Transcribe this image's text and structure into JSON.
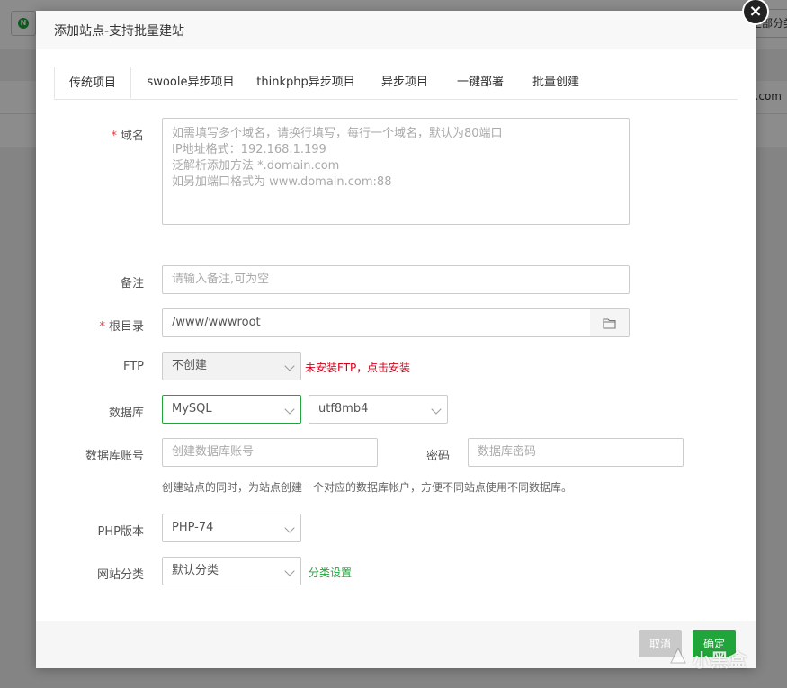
{
  "background": {
    "filter_label": "全部分类",
    "row_text": ".com"
  },
  "dialog": {
    "title": "添加站点-支持批量建站",
    "close_glyph": "×"
  },
  "tabs": [
    {
      "label": "传统项目",
      "active": true
    },
    {
      "label": "swoole异步项目",
      "active": false
    },
    {
      "label": "thinkphp异步项目",
      "active": false
    },
    {
      "label": "异步项目",
      "active": false
    },
    {
      "label": "一键部署",
      "active": false
    },
    {
      "label": "批量创建",
      "active": false
    }
  ],
  "form": {
    "domain": {
      "label": "域名",
      "placeholder_lines": [
        "如需填写多个域名，请换行填写，每行一个域名，默认为80端口",
        "IP地址格式：192.168.1.199",
        "泛解析添加方法 *.domain.com",
        "如另加端口格式为 www.domain.com:88"
      ]
    },
    "remark": {
      "label": "备注",
      "placeholder": "请输入备注,可为空"
    },
    "root": {
      "label": "根目录",
      "value": "/www/wwwroot",
      "folder_icon": "folder-icon"
    },
    "ftp": {
      "label": "FTP",
      "value": "不创建",
      "warning": "未安装FTP，",
      "install_link": "点击安装"
    },
    "database": {
      "label": "数据库",
      "type": "MySQL",
      "charset": "utf8mb4"
    },
    "db_account": {
      "label": "数据库账号",
      "placeholder": "创建数据库账号",
      "password_label": "密码",
      "password_placeholder": "数据库密码",
      "hint": "创建站点的同时，为站点创建一个对应的数据库帐户，方便不同站点使用不同数据库。"
    },
    "php": {
      "label": "PHP版本",
      "value": "PHP-74"
    },
    "category": {
      "label": "网站分类",
      "value": "默认分类",
      "settings_link": "分类设置"
    }
  },
  "footer": {
    "cancel_label": "取消",
    "ok_label": "确定"
  },
  "watermark": "小黑盒",
  "colors": {
    "accent_green": "#20a53a",
    "required_red": "#e4393c",
    "warning_red": "#d9001b"
  }
}
